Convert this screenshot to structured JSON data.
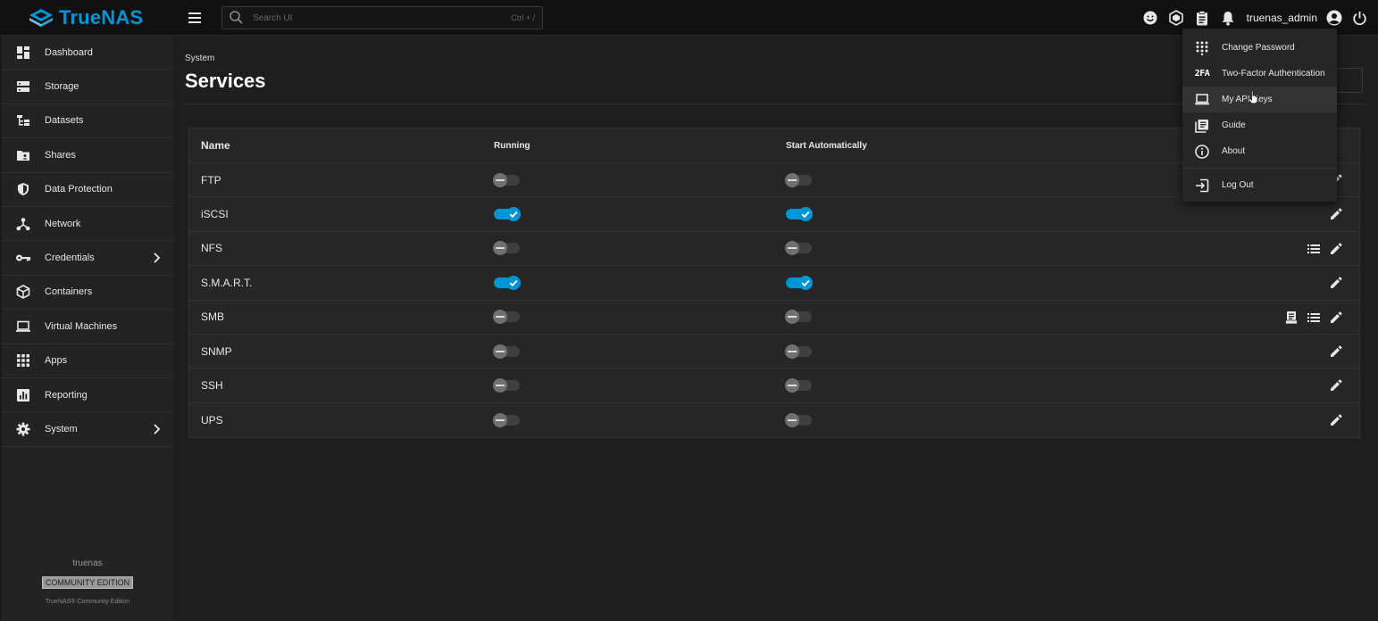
{
  "app": {
    "logo_text": "TrueNAS",
    "brand_color": "#0095d5"
  },
  "search": {
    "placeholder": "Search UI",
    "shortcut": "Ctrl + /"
  },
  "header": {
    "username": "truenas_admin"
  },
  "sidebar": {
    "items": [
      {
        "label": "Dashboard",
        "icon": "dashboard-icon"
      },
      {
        "label": "Storage",
        "icon": "storage-icon"
      },
      {
        "label": "Datasets",
        "icon": "datasets-icon"
      },
      {
        "label": "Shares",
        "icon": "shares-icon"
      },
      {
        "label": "Data Protection",
        "icon": "shield-icon"
      },
      {
        "label": "Network",
        "icon": "network-icon"
      },
      {
        "label": "Credentials",
        "icon": "key-icon"
      },
      {
        "label": "Containers",
        "icon": "cube-icon"
      },
      {
        "label": "Virtual Machines",
        "icon": "laptop-icon"
      },
      {
        "label": "Apps",
        "icon": "apps-grid-icon"
      },
      {
        "label": "Reporting",
        "icon": "reporting-icon"
      },
      {
        "label": "System",
        "icon": "gear-icon"
      }
    ],
    "footer": {
      "hostname": "truenas",
      "edition": "COMMUNITY EDITION",
      "copyright": "TrueNAS® Community Edition"
    }
  },
  "page": {
    "breadcrumb": "System",
    "title": "Services"
  },
  "table": {
    "headers": {
      "name": "Name",
      "running": "Running",
      "auto": "Start Automatically"
    },
    "rows": [
      {
        "name": "FTP",
        "running": false,
        "auto": false
      },
      {
        "name": "iSCSI",
        "running": true,
        "auto": true
      },
      {
        "name": "NFS",
        "running": false,
        "auto": false
      },
      {
        "name": "S.M.A.R.T.",
        "running": true,
        "auto": true
      },
      {
        "name": "SMB",
        "running": false,
        "auto": false
      },
      {
        "name": "SNMP",
        "running": false,
        "auto": false
      },
      {
        "name": "SSH",
        "running": false,
        "auto": false
      },
      {
        "name": "UPS",
        "running": false,
        "auto": false
      }
    ]
  },
  "user_menu": {
    "items": [
      {
        "label": "Change Password",
        "icon": "dialpad-icon"
      },
      {
        "label": "Two-Factor Authentication",
        "icon": "2fa-icon",
        "icon_text": "2FA"
      },
      {
        "label": "My API Keys",
        "icon": "laptop-icon"
      },
      {
        "label": "Guide",
        "icon": "book-icon"
      },
      {
        "label": "About",
        "icon": "info-icon"
      },
      {
        "label": "Log Out",
        "icon": "logout-icon"
      }
    ]
  }
}
